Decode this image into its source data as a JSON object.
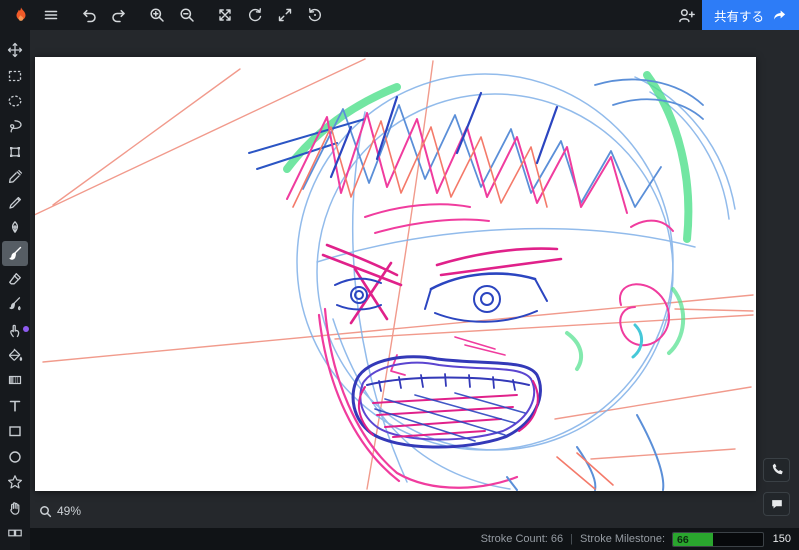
{
  "topbar": {
    "logo": "flame-logo",
    "buttons": [
      {
        "name": "menu"
      },
      {
        "name": "undo"
      },
      {
        "name": "redo"
      },
      {
        "name": "zoom-in"
      },
      {
        "name": "zoom-out"
      },
      {
        "name": "transform-canvas"
      },
      {
        "name": "rotate-canvas"
      },
      {
        "name": "fullscreen"
      },
      {
        "name": "reset-rotation"
      },
      {
        "name": "add-collaborator"
      }
    ],
    "share_button": {
      "label": "共有する",
      "icon": "share-forward-icon"
    }
  },
  "sidebar": {
    "tools": [
      {
        "name": "move",
        "selected": false
      },
      {
        "name": "rectangle-select",
        "selected": false
      },
      {
        "name": "ellipse-select",
        "selected": false
      },
      {
        "name": "lasso-select",
        "selected": false
      },
      {
        "name": "transform",
        "selected": false
      },
      {
        "name": "eyedropper",
        "selected": false
      },
      {
        "name": "pencil",
        "selected": false
      },
      {
        "name": "pen",
        "selected": false
      },
      {
        "name": "brush",
        "selected": true
      },
      {
        "name": "eraser",
        "selected": false
      },
      {
        "name": "blend-brush",
        "selected": false
      },
      {
        "name": "smudge",
        "selected": false,
        "badge": true
      },
      {
        "name": "fill-bucket",
        "selected": false
      },
      {
        "name": "gradient",
        "selected": false
      },
      {
        "name": "text",
        "selected": false
      },
      {
        "name": "rectangle-shape",
        "selected": false
      },
      {
        "name": "ellipse-shape",
        "selected": false
      },
      {
        "name": "star-shape",
        "selected": false
      },
      {
        "name": "hand-pan",
        "selected": false
      },
      {
        "name": "timeline-frames",
        "selected": false
      }
    ]
  },
  "canvas": {
    "zoom_label": "49%"
  },
  "floating_buttons": [
    {
      "name": "voice-call"
    },
    {
      "name": "chat"
    }
  ],
  "statusbar": {
    "stroke_count_text": "Stroke Count: 66",
    "separator": "|",
    "milestone_label": "Stroke Milestone:",
    "milestone_current": "66",
    "milestone_target": "150",
    "progress_fraction": 0.44
  },
  "colors": {
    "accent_blue": "#2d7cf7",
    "progress_green": "#2aa62e",
    "badge_purple": "#8e5bf0",
    "logo_orange": "#f05a28",
    "bar_background": "#16191d"
  }
}
